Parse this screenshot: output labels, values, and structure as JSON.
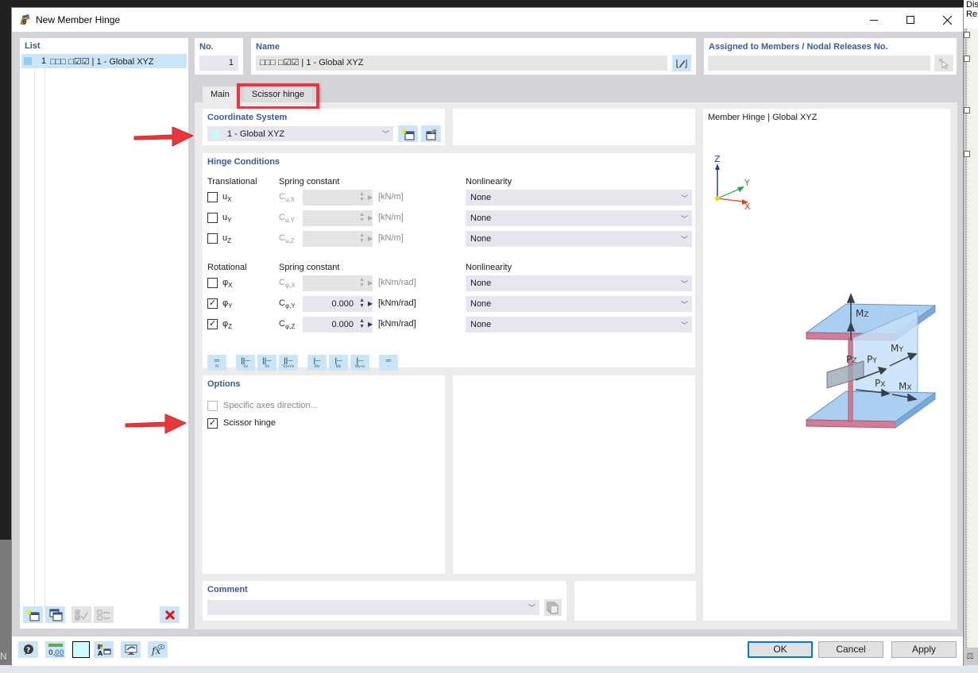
{
  "window": {
    "title": "New Member Hinge",
    "minimize": "—",
    "maximize": "☐",
    "close": "✕"
  },
  "background": {
    "right_text": "Dis\nRe",
    "left_letter": "N"
  },
  "list": {
    "title": "List",
    "items": [
      {
        "number": "1",
        "name": "□□□ □☑☑ | 1 - Global XYZ",
        "color": "#8fd0f0",
        "selected": true
      }
    ],
    "toolbar": [
      "new-item-icon",
      "copy-item-icon",
      "check-all-icon",
      "renumber-icon",
      "delete-icon"
    ]
  },
  "fields": {
    "no_label": "No.",
    "no_value": "1",
    "name_label": "Name",
    "name_value": "□□□ □☑☑ | 1 - Global XYZ",
    "assigned_label": "Assigned to Members / Nodal Releases No.",
    "assigned_value": ""
  },
  "tabs": [
    {
      "label": "Main",
      "active": true
    },
    {
      "label": "Scissor hinge",
      "active": false,
      "highlighted": true
    }
  ],
  "coordinate_system": {
    "title": "Coordinate System",
    "selected": "1 - Global XYZ",
    "swatch_color": "#ccf6fa"
  },
  "hinge_conditions": {
    "title": "Hinge Conditions",
    "translational_header": "Translational",
    "rotational_header": "Rotational",
    "spring_header": "Spring constant",
    "nonlinearity_header": "Nonlinearity",
    "translational": [
      {
        "sym": "u",
        "sub": "X",
        "c_sym": "C",
        "c_sub": "u,X",
        "checked": false,
        "value": "",
        "unit": "[kN/m]",
        "nonlinearity": "None"
      },
      {
        "sym": "u",
        "sub": "Y",
        "c_sym": "C",
        "c_sub": "u,Y",
        "checked": false,
        "value": "",
        "unit": "[kN/m]",
        "nonlinearity": "None"
      },
      {
        "sym": "u",
        "sub": "Z",
        "c_sym": "C",
        "c_sub": "u,Z",
        "checked": false,
        "value": "",
        "unit": "[kN/m]",
        "nonlinearity": "None"
      }
    ],
    "rotational": [
      {
        "sym": "φ",
        "sub": "X",
        "c_sym": "C",
        "c_sub": "φ,X",
        "checked": false,
        "value": "",
        "unit": "[kNm/rad]",
        "nonlinearity": "None"
      },
      {
        "sym": "φ",
        "sub": "Y",
        "c_sym": "C",
        "c_sub": "φ,Y",
        "checked": true,
        "value": "0.000",
        "unit": "[kNm/rad]",
        "nonlinearity": "None"
      },
      {
        "sym": "φ",
        "sub": "Z",
        "c_sym": "C",
        "c_sub": "φ,Z",
        "checked": true,
        "value": "0.000",
        "unit": "[kNm/rad]",
        "nonlinearity": "None"
      }
    ],
    "release_buttons": [
      {
        "name": "release-n-button",
        "sub": "N"
      },
      {
        "name": "release-vy-button",
        "sub": "Vy"
      },
      {
        "name": "release-vz-button",
        "sub": "Vz"
      },
      {
        "name": "release-vyvz-button",
        "sub": "Vy+Vz"
      },
      {
        "name": "release-my-button",
        "sub": "My"
      },
      {
        "name": "release-mz-button",
        "sub": "Mz"
      },
      {
        "name": "release-mymz-button",
        "sub": "My+z"
      },
      {
        "name": "release-none-button",
        "sub": "-"
      }
    ]
  },
  "options": {
    "title": "Options",
    "items": [
      {
        "label": "Specific axes direction...",
        "checked": false,
        "disabled": true
      },
      {
        "label": "Scissor hinge",
        "checked": true,
        "disabled": false
      }
    ]
  },
  "comment": {
    "title": "Comment",
    "value": ""
  },
  "preview": {
    "title": "Member Hinge | Global XYZ",
    "axes": {
      "x": "X",
      "y": "Y",
      "z": "Z"
    },
    "labels": {
      "mz": "M",
      "my": "M",
      "mx": "M",
      "pz": "P",
      "py": "P",
      "px": "P"
    },
    "subs": {
      "mz": "Z",
      "my": "Y",
      "mx": "X",
      "pz": "Z",
      "py": "Y",
      "px": "X"
    },
    "colors": {
      "x_axis": "#d9431c",
      "y_axis": "#22a04a",
      "z_axis": "#1f3fa8",
      "origin": "#f2d500"
    }
  },
  "bottom_toolbar": [
    "help-icon",
    "units-icon",
    "color-icon",
    "display-settings-icon",
    "view-icon",
    "formula-icon"
  ],
  "buttons": {
    "ok": "OK",
    "cancel": "Cancel",
    "apply": "Apply"
  },
  "colors": {
    "accent": "#3c5a94",
    "highlight": "#e8383d",
    "selection": "#cce4f7"
  }
}
